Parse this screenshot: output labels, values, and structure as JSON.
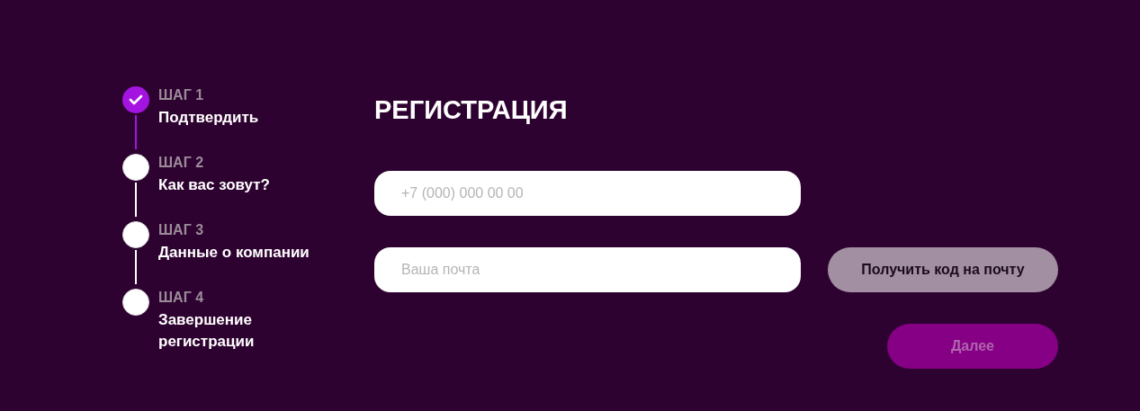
{
  "steps": [
    {
      "label": "ШАГ 1",
      "title": "Подтвердить",
      "completed": true
    },
    {
      "label": "ШАГ 2",
      "title": "Как вас зовут?",
      "completed": false
    },
    {
      "label": "ШАГ 3",
      "title": "Данные о компании",
      "completed": false
    },
    {
      "label": "ШАГ 4",
      "title": "Завершение регистрации",
      "completed": false
    }
  ],
  "form": {
    "title": "РЕГИСТРАЦИЯ",
    "phone": {
      "placeholder": "+7 (000) 000 00 00"
    },
    "email": {
      "placeholder": "Ваша почта"
    },
    "get_code_button": {
      "label": "Получить код на почту",
      "disabled": false
    },
    "next_button": {
      "label": "Далее",
      "disabled": true
    }
  }
}
